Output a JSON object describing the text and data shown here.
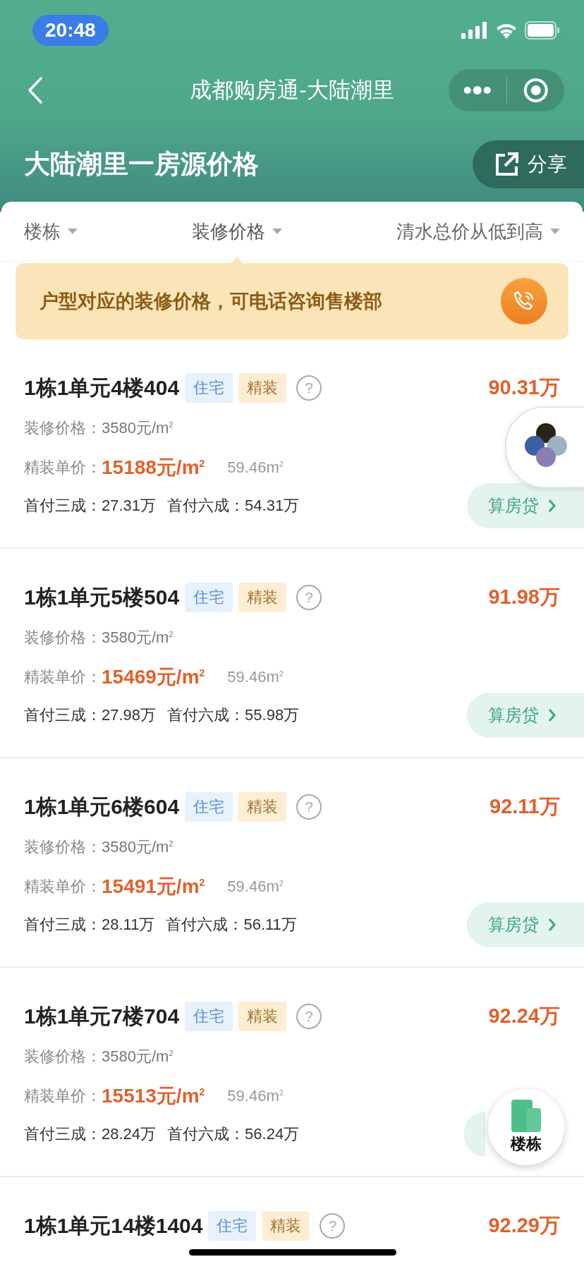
{
  "status_bar": {
    "time": "20:48"
  },
  "nav_bar": {
    "title": "成都购房通-大陆潮里"
  },
  "header": {
    "title": "大陆潮里一房源价格",
    "share_button": "分享"
  },
  "filters": [
    {
      "label": "楼栋",
      "selected": false
    },
    {
      "label": "装修价格",
      "selected": true
    },
    {
      "label": "清水总价从低到高",
      "selected": false
    }
  ],
  "tip": {
    "text": "户型对应的装修价格，可电话咨询售楼部"
  },
  "units": [
    {
      "name": "1栋1单元4楼404",
      "tags": [
        {
          "label": "住宅",
          "kind": "type"
        },
        {
          "label": "精装",
          "kind": "finish"
        }
      ],
      "help": "?",
      "price": "90.31万",
      "deco_label": "装修价格：",
      "deco_value": "3580元/m$^{2}$",
      "unit_label": "精装单价：",
      "unit_price": "15188元/m$^{2}$",
      "area": "59.46m$^{2}$",
      "down_30": "首付三成：27.31万",
      "down_60": "首付六成：54.31万",
      "loan_button": "算房贷"
    },
    {
      "name": "1栋1单元5楼504",
      "tags": [
        {
          "label": "住宅",
          "kind": "type"
        },
        {
          "label": "精装",
          "kind": "finish"
        }
      ],
      "help": "?",
      "price": "91.98万",
      "deco_label": "装修价格：",
      "deco_value": "3580元/m$^{2}$",
      "unit_label": "精装单价：",
      "unit_price": "15469元/m$^{2}$",
      "area": "59.46m$^{2}$",
      "down_30": "首付三成：27.98万",
      "down_60": "首付六成：55.98万",
      "loan_button": "算房贷"
    },
    {
      "name": "1栋1单元6楼604",
      "tags": [
        {
          "label": "住宅",
          "kind": "type"
        },
        {
          "label": "精装",
          "kind": "finish"
        }
      ],
      "help": "?",
      "price": "92.11万",
      "deco_label": "装修价格：",
      "deco_value": "3580元/m$^{2}$",
      "unit_label": "精装单价：",
      "unit_price": "15491元/m$^{2}$",
      "area": "59.46m$^{2}$",
      "down_30": "首付三成：28.11万",
      "down_60": "首付六成：56.11万",
      "loan_button": "算房贷"
    },
    {
      "name": "1栋1单元7楼704",
      "tags": [
        {
          "label": "住宅",
          "kind": "type"
        },
        {
          "label": "精装",
          "kind": "finish"
        }
      ],
      "help": "?",
      "price": "92.24万",
      "deco_label": "装修价格：",
      "deco_value": "3580元/m$^{2}$",
      "unit_label": "精装单价：",
      "unit_price": "15513元/m$^{2}$",
      "area": "59.46m$^{2}$",
      "down_30": "首付三成：28.24万",
      "down_60": "首付六成：56.24万"
    },
    {
      "name": "1栋1单元14楼1404",
      "tags": [
        {
          "label": "住宅",
          "kind": "type"
        },
        {
          "label": "精装",
          "kind": "finish"
        }
      ],
      "help": "?",
      "price": "92.29万"
    }
  ],
  "floating_button": {
    "label": "楼栋"
  }
}
